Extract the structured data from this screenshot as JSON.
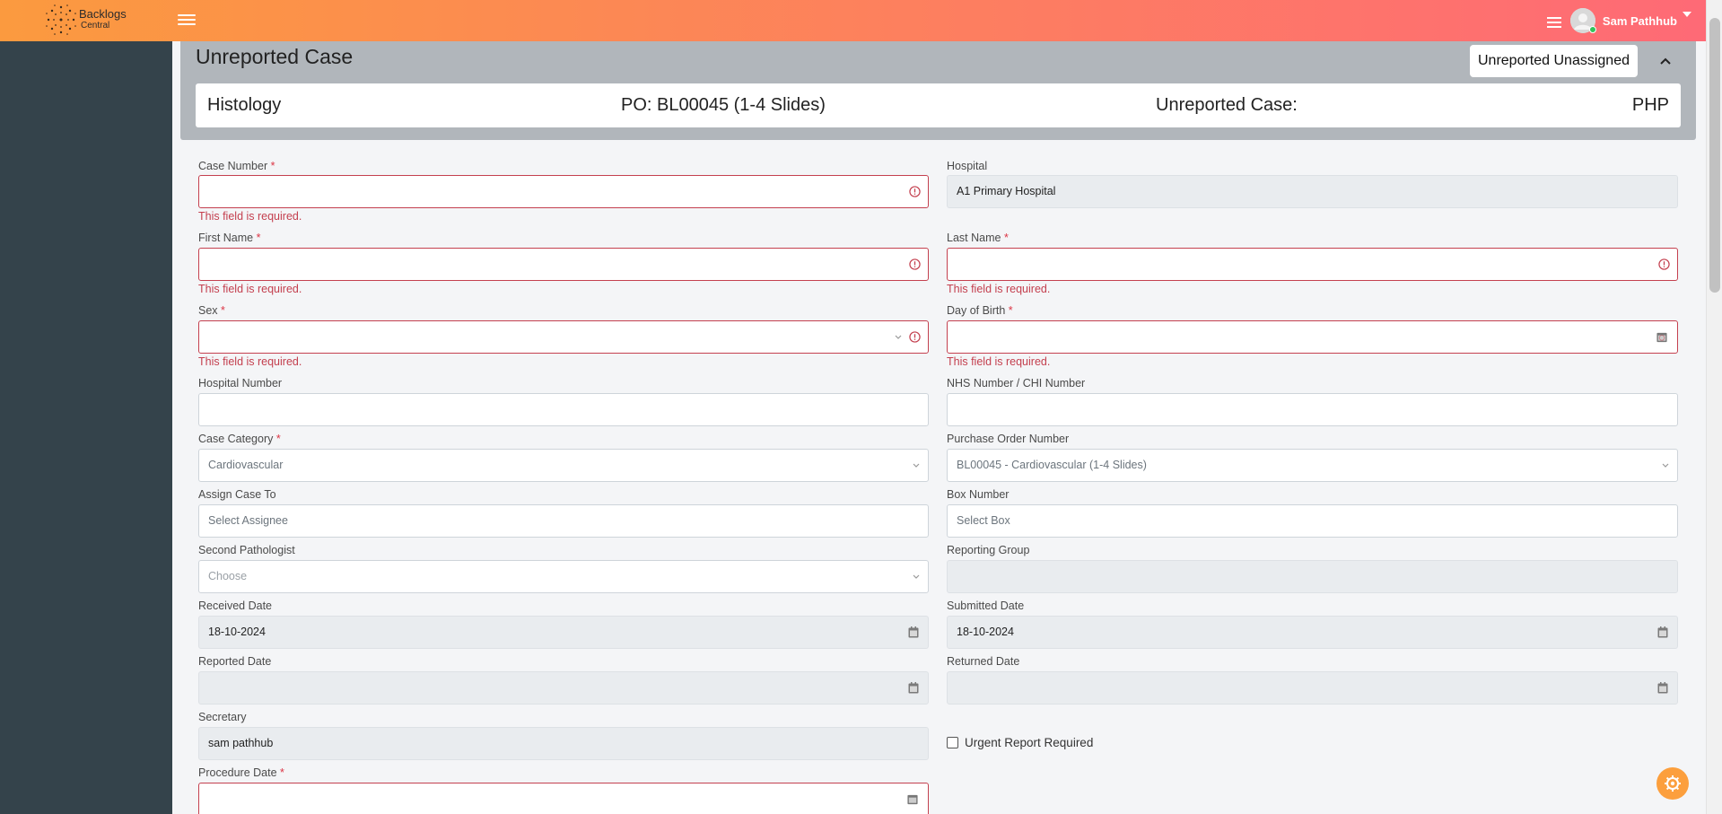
{
  "brand": {
    "line1": "Backlogs",
    "line2": "Central"
  },
  "user": {
    "name": "Sam Pathhub"
  },
  "header": {
    "title": "Unreported Case",
    "status_pill": "Unreported Unassigned",
    "info": {
      "discipline": "Histology",
      "po": "PO: BL00045 (1-4 Slides)",
      "unreported_label": "Unreported Case:",
      "code": "PHP"
    }
  },
  "form": {
    "error_text": "This field is required.",
    "required_mark": "*",
    "case_number": {
      "label": "Case Number",
      "value": ""
    },
    "hospital": {
      "label": "Hospital",
      "value": "A1 Primary Hospital"
    },
    "first_name": {
      "label": "First Name",
      "value": ""
    },
    "last_name": {
      "label": "Last Name",
      "value": ""
    },
    "sex": {
      "label": "Sex",
      "value": ""
    },
    "dob": {
      "label": "Day of Birth",
      "value": ""
    },
    "hospital_number": {
      "label": "Hospital Number",
      "value": ""
    },
    "nhs_number": {
      "label": "NHS Number / CHI Number",
      "value": ""
    },
    "case_category": {
      "label": "Case Category",
      "value": "Cardiovascular"
    },
    "po_number": {
      "label": "Purchase Order Number",
      "value": "BL00045 - Cardiovascular (1-4 Slides)"
    },
    "assign_to": {
      "label": "Assign Case To",
      "placeholder": "Select Assignee"
    },
    "box_number": {
      "label": "Box Number",
      "placeholder": "Select Box"
    },
    "second_pathologist": {
      "label": "Second Pathologist",
      "placeholder": "Choose"
    },
    "reporting_group": {
      "label": "Reporting Group",
      "value": ""
    },
    "received_date": {
      "label": "Received Date",
      "value": "18-10-2024"
    },
    "submitted_date": {
      "label": "Submitted Date",
      "value": "18-10-2024"
    },
    "reported_date": {
      "label": "Reported Date",
      "value": ""
    },
    "returned_date": {
      "label": "Returned Date",
      "value": ""
    },
    "secretary": {
      "label": "Secretary",
      "value": "sam pathhub"
    },
    "urgent": {
      "label": "Urgent Report Required",
      "checked": false
    },
    "procedure_date": {
      "label": "Procedure Date",
      "value": ""
    }
  },
  "colors": {
    "accent_start": "#fb9a3f",
    "accent_end": "#fe6a76",
    "sidebar": "#34434b",
    "error": "#c4404f"
  }
}
